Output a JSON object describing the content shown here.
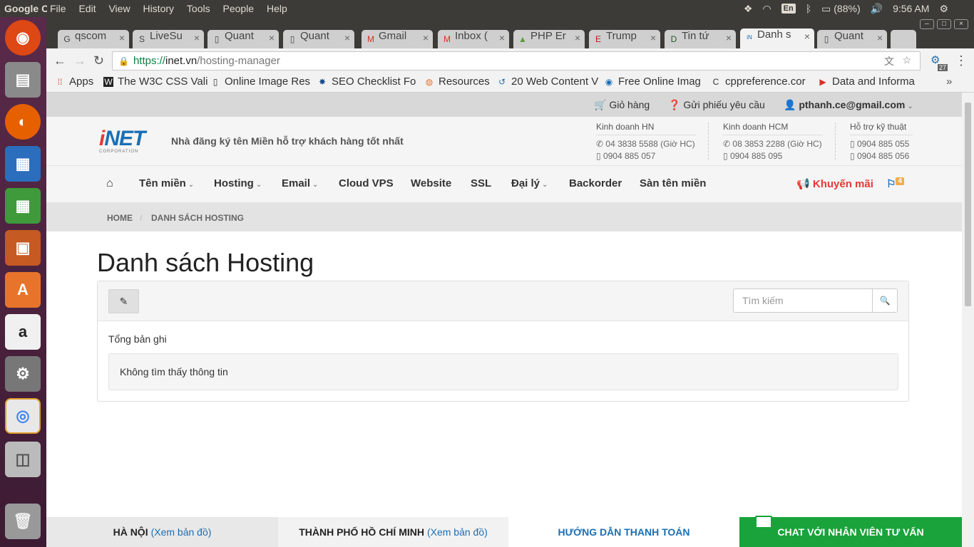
{
  "ubuntu_panel": {
    "app_name": "Google Chrome",
    "menu": [
      "File",
      "Edit",
      "View",
      "History",
      "Tools",
      "People",
      "Help"
    ],
    "keyboard": "En",
    "battery": "(88%)",
    "clock": "9:56 AM"
  },
  "launcher": {
    "apps": [
      "Ubuntu",
      "Files",
      "Firefox",
      "LibreOffice Writer",
      "LibreOffice Calc",
      "LibreOffice Impress",
      "Ubuntu Software",
      "Amazon",
      "System Settings",
      "Chrome",
      "Disk",
      "Trash"
    ]
  },
  "tabs": [
    {
      "label": "qscom",
      "icon": "google-icon"
    },
    {
      "label": "LiveSu",
      "icon": "livesupport-icon"
    },
    {
      "label": "Quant",
      "icon": "page-icon"
    },
    {
      "label": "Quant",
      "icon": "page-icon"
    },
    {
      "label": "Gmail",
      "icon": "gmail-icon"
    },
    {
      "label": "Inbox (",
      "icon": "gmail-icon"
    },
    {
      "label": "PHP Er",
      "icon": "php-icon"
    },
    {
      "label": "Trump",
      "icon": "trump-icon"
    },
    {
      "label": "Tin tứ",
      "icon": "d-icon"
    },
    {
      "label": "Danh s",
      "icon": "inet-icon",
      "active": true
    },
    {
      "label": "Quant",
      "icon": "page-icon"
    }
  ],
  "address": {
    "scheme": "https://",
    "host": "inet.vn",
    "path": "/hosting-manager",
    "extension_badge": "27"
  },
  "bookmarks": [
    {
      "label": "Apps",
      "icon": "apps-grid-icon"
    },
    {
      "label": "The W3C CSS Vali",
      "icon": "w3c-icon"
    },
    {
      "label": "Online Image Res",
      "icon": "page-icon"
    },
    {
      "label": "SEO Checklist Fo",
      "icon": "gear-icon"
    },
    {
      "label": "Resources",
      "icon": "resources-icon"
    },
    {
      "label": "20 Web Content V",
      "icon": "content-icon"
    },
    {
      "label": "Free Online Imag",
      "icon": "globe-icon"
    },
    {
      "label": "cppreference.cor",
      "icon": "cpp-icon"
    },
    {
      "label": "Data and Informa",
      "icon": "play-icon"
    }
  ],
  "site": {
    "top_links": {
      "cart": "Giỏ hàng",
      "ticket": "Gửi phiếu yêu cầu",
      "user": "pthanh.ce@gmail.com"
    },
    "logo": {
      "brand_i": "i",
      "brand_rest": "NET",
      "corp": "CORPORATION"
    },
    "slogan": "Nhà đăng ký tên Miền hỗ trợ khách hàng tốt nhất",
    "contacts": [
      {
        "title": "Kinh doanh HN",
        "phone": "04 3838 5588 (Giờ HC)",
        "mobile": "0904 885 057"
      },
      {
        "title": "Kinh doanh HCM",
        "phone": "08 3853 2288 (Giờ HC)",
        "mobile": "0904 885 095"
      },
      {
        "title": "Hỗ trợ kỹ thuật",
        "mobile1": "0904 885 055",
        "mobile2": "0904 885 056"
      }
    ],
    "nav": [
      "Tên miền",
      "Hosting",
      "Email",
      "Cloud VPS",
      "Website",
      "SSL",
      "Đại lý",
      "Backorder",
      "Sàn tên miền"
    ],
    "promo": "Khuyến mãi",
    "notifications": "4",
    "breadcrumb": {
      "home": "HOME",
      "current": "DANH SÁCH HOSTING"
    },
    "title": "Danh sách Hosting",
    "search_placeholder": "Tìm kiếm",
    "total_label": "Tổng bản ghi",
    "empty_message": "Không tìm thấy thông tin",
    "footer": {
      "hanoi": "HÀ NỘI",
      "hanoi_map": "(Xem bản đồ)",
      "hcm": "THÀNH PHỐ HỒ CHÍ MINH",
      "hcm_map": "(Xem bản đồ)",
      "payment": "HƯỚNG DẪN THANH TOÁN",
      "chat": "CHAT VỚI NHÂN VIÊN TƯ VẤN"
    }
  }
}
